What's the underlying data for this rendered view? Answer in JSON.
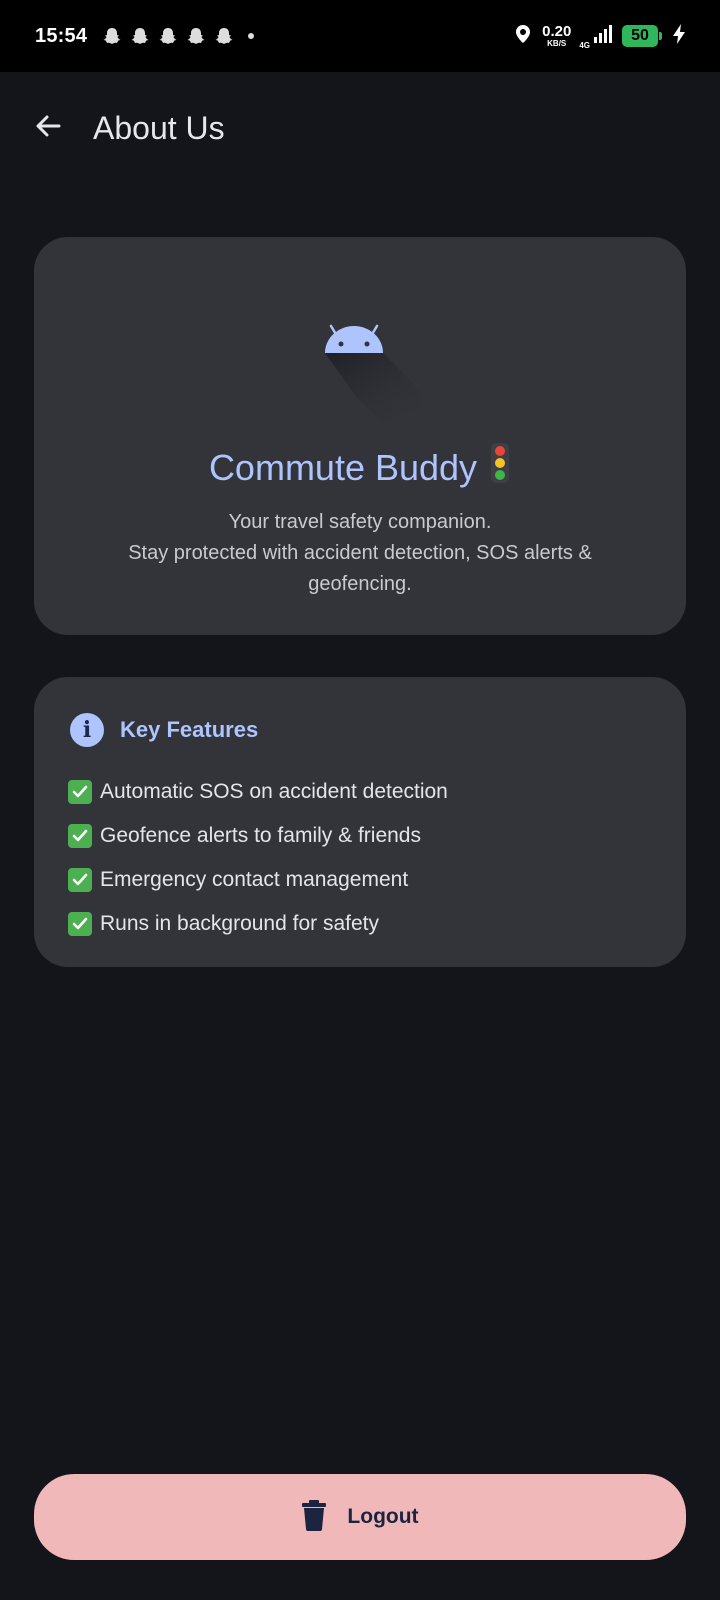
{
  "status_bar": {
    "time": "15:54",
    "net_speed_value": "0.20",
    "net_speed_unit": "KB/S",
    "network_type": "4G",
    "battery_level": "50",
    "icons": [
      "snapchat-icon",
      "snapchat-icon",
      "snapchat-icon",
      "snapchat-icon",
      "snapchat-icon",
      "dot-icon",
      "location-icon",
      "signal-icon",
      "battery-icon",
      "charging-icon"
    ]
  },
  "app_bar": {
    "title": "About Us",
    "back_icon": "arrow-back-icon"
  },
  "about": {
    "app_name": "Commute Buddy",
    "tagline_line1": "Your travel safety companion.",
    "tagline_line2": "Stay protected with accident detection, SOS alerts & geofencing."
  },
  "features": {
    "title": "Key Features",
    "items": [
      "Automatic SOS on accident detection",
      "Geofence alerts to family & friends",
      "Emergency contact management",
      "Runs in background for safety"
    ]
  },
  "logout": {
    "label": "Logout",
    "icon": "trash-icon"
  },
  "colors": {
    "background": "#13151b",
    "card": "#33343a",
    "accent": "#aec4ff",
    "logout_bg": "#f0b8b8",
    "battery": "#2fb75c"
  }
}
